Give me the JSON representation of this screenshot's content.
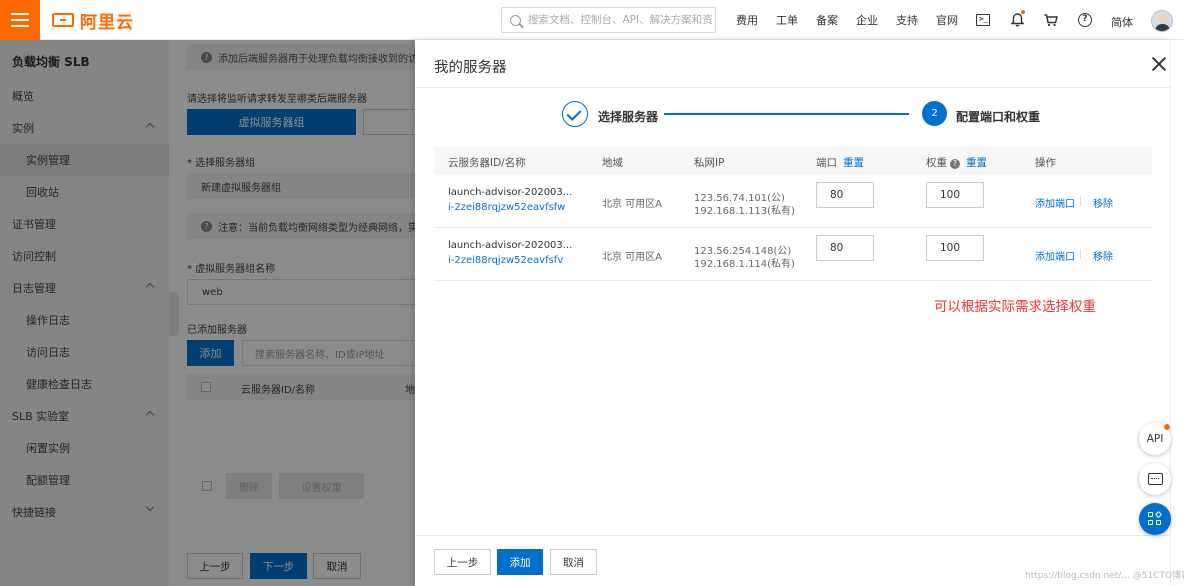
{
  "topbar": {
    "logo_text": "阿里云",
    "search_placeholder": "搜索文档、控制台、API、解决方案和资源",
    "nav_links": [
      "费用",
      "工单",
      "备案",
      "企业",
      "支持",
      "官网"
    ],
    "terminal_icon_text": ">_",
    "help_icon_text": "?",
    "lang": "简体"
  },
  "sidebar": {
    "title": "负载均衡 SLB",
    "items": [
      {
        "label": "概览"
      },
      {
        "label": "实例"
      },
      {
        "label": "实例管理"
      },
      {
        "label": "回收站"
      },
      {
        "label": "证书管理"
      },
      {
        "label": "访问控制"
      },
      {
        "label": "日志管理"
      },
      {
        "label": "操作日志"
      },
      {
        "label": "访问日志"
      },
      {
        "label": "健康检查日志"
      },
      {
        "label": "SLB 实验室"
      },
      {
        "label": "闲置实例"
      },
      {
        "label": "配额管理"
      },
      {
        "label": "快捷链接"
      }
    ]
  },
  "background_page": {
    "tip": "添加后端服务器用于处理负载均衡接收到的访",
    "select_label": "请选择将监听请求转发至哪类后端服务器",
    "vserver_group_btn": "虚拟服务器组",
    "choose_group_label": "* 选择服务器组",
    "new_group_value": "新建虚拟服务器组",
    "note": "注意：当前负载均衡网络类型为经典网络，实例",
    "group_name_label": "* 虚拟服务器组名称",
    "group_name_value": "web",
    "added_label": "已添加服务器",
    "add_btn": "添加",
    "search_placeholder": "搜索服务器名称、ID或IP地址",
    "col_id": "云服务器ID/名称",
    "col_region_partial": "地",
    "remove_btn": "删除",
    "set_weight_btn": "设置权重",
    "prev_btn": "上一步",
    "next_btn": "下一步",
    "cancel_btn": "取消"
  },
  "drawer": {
    "title": "我的服务器",
    "step1_label": "选择服务器",
    "step2_number": "2",
    "step2_label": "配置端口和权重",
    "columns": {
      "server": "云服务器ID/名称",
      "region": "地域",
      "private_ip": "私网IP",
      "port": "端口",
      "weight": "权重",
      "weight_help": "?",
      "reset": "重置",
      "actions": "操作"
    },
    "rows": [
      {
        "name": "launch-advisor-202003...",
        "id": "i-2zei88rqjzw52eavfsfw",
        "region": "北京 可用区A",
        "public_ip": "123.56.74.101(公)",
        "private_ip": "192.168.1.113(私有)",
        "port": "80",
        "weight": "100",
        "add_port": "添加端口",
        "remove": "移除"
      },
      {
        "name": "launch-advisor-202003...",
        "id": "i-2zei88rqjzw52eavfsfv",
        "region": "北京 可用区A",
        "public_ip": "123.56.254.148(公)",
        "private_ip": "192.168.1.114(私有)",
        "port": "80",
        "weight": "100",
        "add_port": "添加端口",
        "remove": "移除"
      }
    ],
    "annotation": "可以根据实际需求选择权重",
    "footer": {
      "prev": "上一步",
      "add": "添加",
      "cancel": "取消"
    }
  },
  "floating": {
    "api": "API"
  },
  "watermark": "https://blog.csdn.net/... @51CTO博客",
  "colors": {
    "brand_orange": "#ff6a00",
    "primary_blue": "#0070cc",
    "annotation_red": "#ee3333"
  }
}
